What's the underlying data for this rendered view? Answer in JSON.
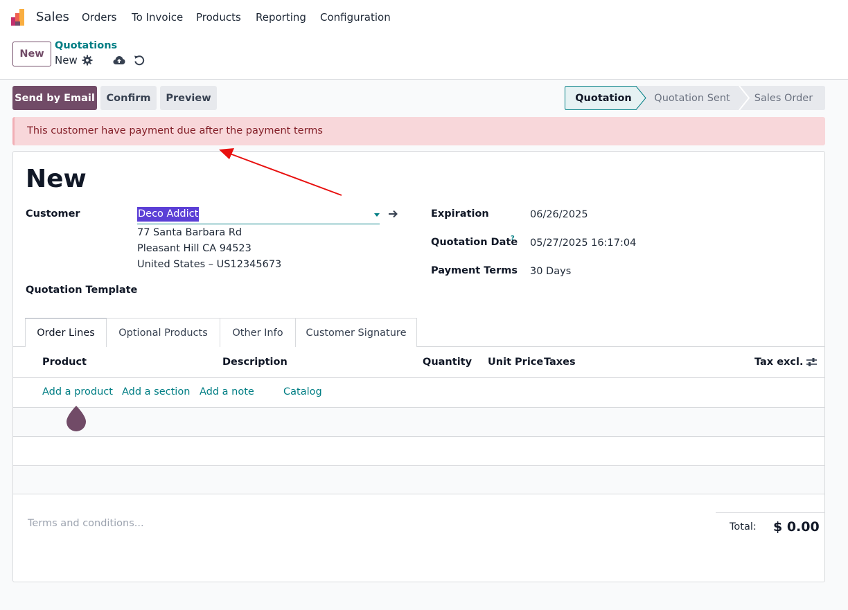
{
  "topbar": {
    "app_name": "Sales",
    "menu": [
      "Orders",
      "To Invoice",
      "Products",
      "Reporting",
      "Configuration"
    ],
    "logo_colors": [
      "#f9ae41",
      "#f06050",
      "#c22f6d",
      "#714b67"
    ]
  },
  "controlbar": {
    "new_button": "New",
    "breadcrumb_parent": "Quotations",
    "breadcrumb_current": "New",
    "icons": [
      "gear-icon",
      "cloud-upload-icon",
      "undo-icon"
    ]
  },
  "actions": {
    "send_by_email": "Send by Email",
    "confirm": "Confirm",
    "preview": "Preview"
  },
  "statusbar": {
    "stages": [
      "Quotation",
      "Quotation Sent",
      "Sales Order"
    ],
    "active_stage": "Quotation"
  },
  "alert": {
    "message": "This customer have payment due after the payment terms"
  },
  "form": {
    "title": "New",
    "customer_label": "Customer",
    "customer_value": "Deco Addict",
    "address_line1": "77 Santa Barbara Rd",
    "address_line2": "Pleasant Hill CA 94523",
    "address_line3": "United States – US12345673",
    "quotation_template_label": "Quotation Template",
    "expiration_label": "Expiration",
    "expiration_value": "06/26/2025",
    "quotation_date_label": "Quotation Date",
    "quotation_date_help": "?",
    "quotation_date_value": "05/27/2025 16:17:04",
    "payment_terms_label": "Payment Terms",
    "payment_terms_value": "30 Days"
  },
  "tabs": [
    "Order Lines",
    "Optional Products",
    "Other Info",
    "Customer Signature"
  ],
  "table": {
    "headers": {
      "product": "Product",
      "description": "Description",
      "quantity": "Quantity",
      "unit_price": "Unit Price",
      "taxes": "Taxes",
      "tax_excl": "Tax excl."
    },
    "add_links": {
      "add_product": "Add a product",
      "add_section": "Add a section",
      "add_note": "Add a note",
      "catalog": "Catalog"
    }
  },
  "footer": {
    "terms_placeholder": "Terms and conditions...",
    "total_label": "Total:",
    "total_value": "$ 0.00"
  },
  "colors": {
    "primary": "#714b67",
    "accent": "#017e84",
    "alert_bg": "#f8d7da",
    "alert_text": "#842029",
    "annotation_arrow": "#e8100f"
  }
}
